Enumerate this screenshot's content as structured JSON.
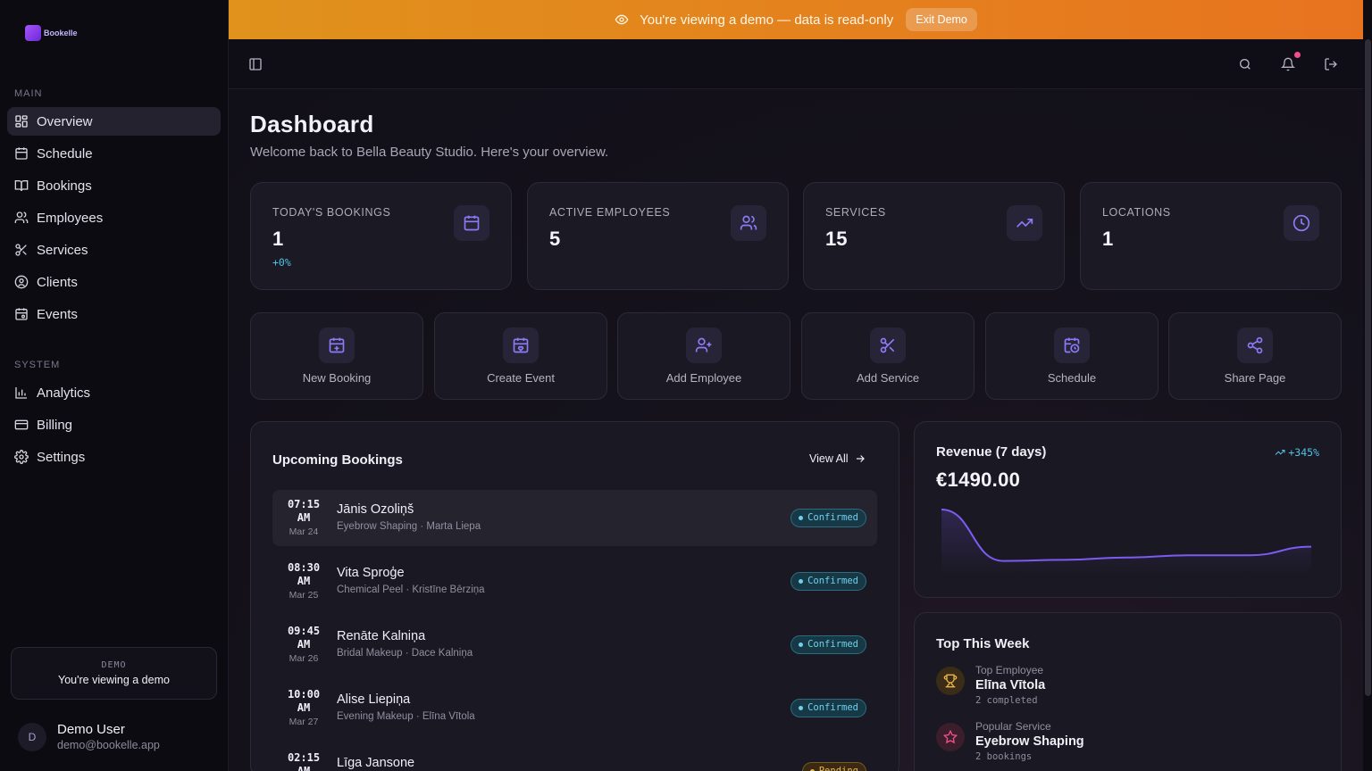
{
  "sidebar": {
    "logo_text": "Bookelle",
    "sections": {
      "main": "MAIN",
      "system": "SYSTEM"
    },
    "items": [
      {
        "label": "Overview",
        "icon": "grid-icon"
      },
      {
        "label": "Schedule",
        "icon": "calendar-icon"
      },
      {
        "label": "Bookings",
        "icon": "book-open-icon"
      },
      {
        "label": "Employees",
        "icon": "users-icon"
      },
      {
        "label": "Services",
        "icon": "scissors-icon"
      },
      {
        "label": "Clients",
        "icon": "user-circle-icon"
      },
      {
        "label": "Events",
        "icon": "calendar-event-icon"
      },
      {
        "label": "Analytics",
        "icon": "bar-chart-icon"
      },
      {
        "label": "Billing",
        "icon": "credit-card-icon"
      },
      {
        "label": "Settings",
        "icon": "gear-icon"
      }
    ],
    "demo_tag": "DEMO",
    "demo_message": "You're viewing a demo",
    "user": {
      "initial": "D",
      "name": "Demo User",
      "email": "demo@bookelle.app"
    }
  },
  "banner": {
    "message": "You're viewing a demo — data is read-only",
    "exit_label": "Exit Demo",
    "color_start": "#e0921c",
    "color_end": "#e8731f"
  },
  "header": {
    "title": "Dashboard",
    "subtitle": "Welcome back to Bella Beauty Studio. Here's your overview."
  },
  "stats": [
    {
      "label": "TODAY'S BOOKINGS",
      "value": "1",
      "delta": "+0%",
      "icon": "calendar-icon"
    },
    {
      "label": "ACTIVE EMPLOYEES",
      "value": "5",
      "delta": "",
      "icon": "users-icon"
    },
    {
      "label": "SERVICES",
      "value": "15",
      "delta": "",
      "icon": "trending-up-icon"
    },
    {
      "label": "LOCATIONS",
      "value": "1",
      "delta": "",
      "icon": "clock-icon"
    }
  ],
  "actions": [
    {
      "label": "New Booking",
      "icon": "calendar-plus-icon"
    },
    {
      "label": "Create Event",
      "icon": "calendar-heart-icon"
    },
    {
      "label": "Add Employee",
      "icon": "user-plus-icon"
    },
    {
      "label": "Add Service",
      "icon": "scissors-icon"
    },
    {
      "label": "Schedule",
      "icon": "calendar-clock-icon"
    },
    {
      "label": "Share Page",
      "icon": "share-icon"
    }
  ],
  "upcoming": {
    "title": "Upcoming Bookings",
    "view_all": "View All",
    "bookings": [
      {
        "time": "07:15",
        "ampm": "AM",
        "date": "Mar 24",
        "name": "Jānis Ozoliņš",
        "detail": "Eyebrow Shaping · Marta Liepa",
        "status": "Confirmed"
      },
      {
        "time": "08:30",
        "ampm": "AM",
        "date": "Mar 25",
        "name": "Vita Sproģe",
        "detail": "Chemical Peel · Kristīne Bērziņa",
        "status": "Confirmed"
      },
      {
        "time": "09:45",
        "ampm": "AM",
        "date": "Mar 26",
        "name": "Renāte Kalniņa",
        "detail": "Bridal Makeup · Dace Kalniņa",
        "status": "Confirmed"
      },
      {
        "time": "10:00",
        "ampm": "AM",
        "date": "Mar 27",
        "name": "Alise Liepiņa",
        "detail": "Evening Makeup · Elīna Vītola",
        "status": "Confirmed"
      },
      {
        "time": "02:15",
        "ampm": "AM",
        "date": "",
        "name": "Līga Jansone",
        "detail": "",
        "status": "Pending"
      }
    ]
  },
  "revenue": {
    "title": "Revenue (7 days)",
    "value": "€1490.00",
    "delta": "+345%",
    "line_color": "#7c5cf0"
  },
  "chart_data": {
    "type": "area",
    "values": [
      1.0,
      0.1,
      0.12,
      0.16,
      0.2,
      0.2,
      0.35
    ],
    "title": "Revenue (7 days)"
  },
  "top_week": {
    "title": "Top This Week",
    "items": [
      {
        "label": "Top Employee",
        "name": "Elīna Vītola",
        "sub": "2 completed",
        "icon": "trophy-icon"
      },
      {
        "label": "Popular Service",
        "name": "Eyebrow Shaping",
        "sub": "2 bookings",
        "icon": "star-icon"
      }
    ]
  },
  "colors": {
    "accent": "#8b7cf6",
    "cyan": "#4fc3e6"
  }
}
